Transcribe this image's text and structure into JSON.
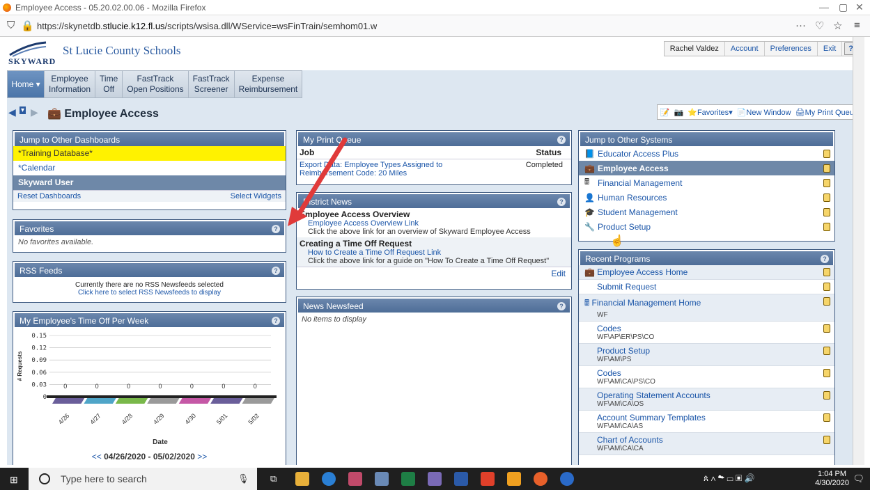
{
  "window": {
    "title": "Employee Access - 05.20.02.00.06 - Mozilla Firefox"
  },
  "browser": {
    "url_prefix": "https://skynetdb.",
    "url_domain": "stlucie.k12.fl.us",
    "url_path": "/scripts/wsisa.dll/WService=wsFinTrain/semhom01.w"
  },
  "header": {
    "logo_text": "SKYWARD",
    "district": "St Lucie County Schools",
    "user": "Rachel Valdez",
    "account": "Account",
    "preferences": "Preferences",
    "exit": "Exit",
    "help": "?"
  },
  "nav": {
    "home": "Home",
    "items": [
      [
        "Employee",
        "Information"
      ],
      [
        "Time",
        "Off"
      ],
      [
        "FastTrack",
        "Open Positions"
      ],
      [
        "FastTrack",
        "Screener"
      ],
      [
        "Expense",
        "Reimbursement"
      ]
    ]
  },
  "page": {
    "title": "Employee Access"
  },
  "tools": {
    "favorites": "Favorites",
    "new_window": "New Window",
    "print_queue": "My Print Queue"
  },
  "dashboards": {
    "title": "Jump to Other Dashboards",
    "items": [
      "*Training Database*",
      "*Calendar",
      "Skyward User"
    ],
    "reset": "Reset Dashboards",
    "select": "Select Widgets"
  },
  "favorites": {
    "title": "Favorites",
    "empty": "No favorites available."
  },
  "rss": {
    "title": "RSS Feeds",
    "line1": "Currently there are no RSS Newsfeeds selected",
    "line2": "Click here to select RSS Newsfeeds to display"
  },
  "timeoff": {
    "title": "My Employee's Time Off Per Week",
    "range_prev": "<<",
    "range": "04/26/2020 - 05/02/2020",
    "range_next": ">>"
  },
  "chart_data": {
    "type": "bar",
    "title": "",
    "xlabel": "Date",
    "ylabel": "# Requests",
    "categories": [
      "4/26",
      "4/27",
      "4/28",
      "4/29",
      "4/30",
      "5/01",
      "5/02"
    ],
    "values": [
      0,
      0,
      0,
      0,
      0,
      0,
      0
    ],
    "yticks": [
      "0.15",
      "0.12",
      "0.09",
      "0.06",
      "0.03",
      "0"
    ],
    "ylim": [
      0,
      0.15
    ],
    "colors": [
      "#6a5e9a",
      "#4fa5c8",
      "#79b84a",
      "#9a9a9a",
      "#c558a6",
      "#6a5e9a",
      "#9a9a9a"
    ]
  },
  "printqueue": {
    "title": "My Print Queue",
    "col_job": "Job",
    "col_status": "Status",
    "job_line1": "Export Data: Employee Types Assigned to",
    "job_line2": "Reimbursement Code: 20 Miles",
    "status": "Completed"
  },
  "news": {
    "title": "District News",
    "items": [
      {
        "title": "Employee Access Overview",
        "link": "Employee Access Overview Link",
        "desc": "Click the above link for an overview of Skyward Employee Access"
      },
      {
        "title": "Creating a Time Off Request",
        "link": "How to Create a Time Off Request Link",
        "desc": "Click the above link for a guide on \"How To Create a Time Off Request\""
      }
    ],
    "edit": "Edit"
  },
  "newsfeed": {
    "title": "News Newsfeed",
    "empty": "No items to display"
  },
  "systems": {
    "title": "Jump to Other Systems",
    "items": [
      {
        "label": "Educator Access Plus",
        "icon": "book-icon"
      },
      {
        "label": "Employee Access",
        "icon": "briefcase-icon"
      },
      {
        "label": "Financial Management",
        "icon": "calculator-icon"
      },
      {
        "label": "Human Resources",
        "icon": "person-icon"
      },
      {
        "label": "Student Management",
        "icon": "graduation-cap-icon"
      },
      {
        "label": "Product Setup",
        "icon": "wrench-icon"
      }
    ]
  },
  "recent": {
    "title": "Recent Programs",
    "items": [
      {
        "name": "Employee Access Home",
        "path": ""
      },
      {
        "name": "Submit Request",
        "path": ""
      },
      {
        "name": "Financial Management Home",
        "path": "WF"
      },
      {
        "name": "Codes",
        "path": "WF\\AP\\ER\\PS\\CO"
      },
      {
        "name": "Product Setup",
        "path": "WF\\AM\\PS"
      },
      {
        "name": "Codes",
        "path": "WF\\AM\\CA\\PS\\CO"
      },
      {
        "name": "Operating Statement Accounts",
        "path": "WF\\AM\\CA\\OS"
      },
      {
        "name": "Account Summary Templates",
        "path": "WF\\AM\\CA\\AS"
      },
      {
        "name": "Chart of Accounts",
        "path": "WF\\AM\\CA\\CA"
      }
    ]
  },
  "taskbar": {
    "search": "Type here to search",
    "time": "1:04 PM",
    "date": "4/30/2020"
  }
}
